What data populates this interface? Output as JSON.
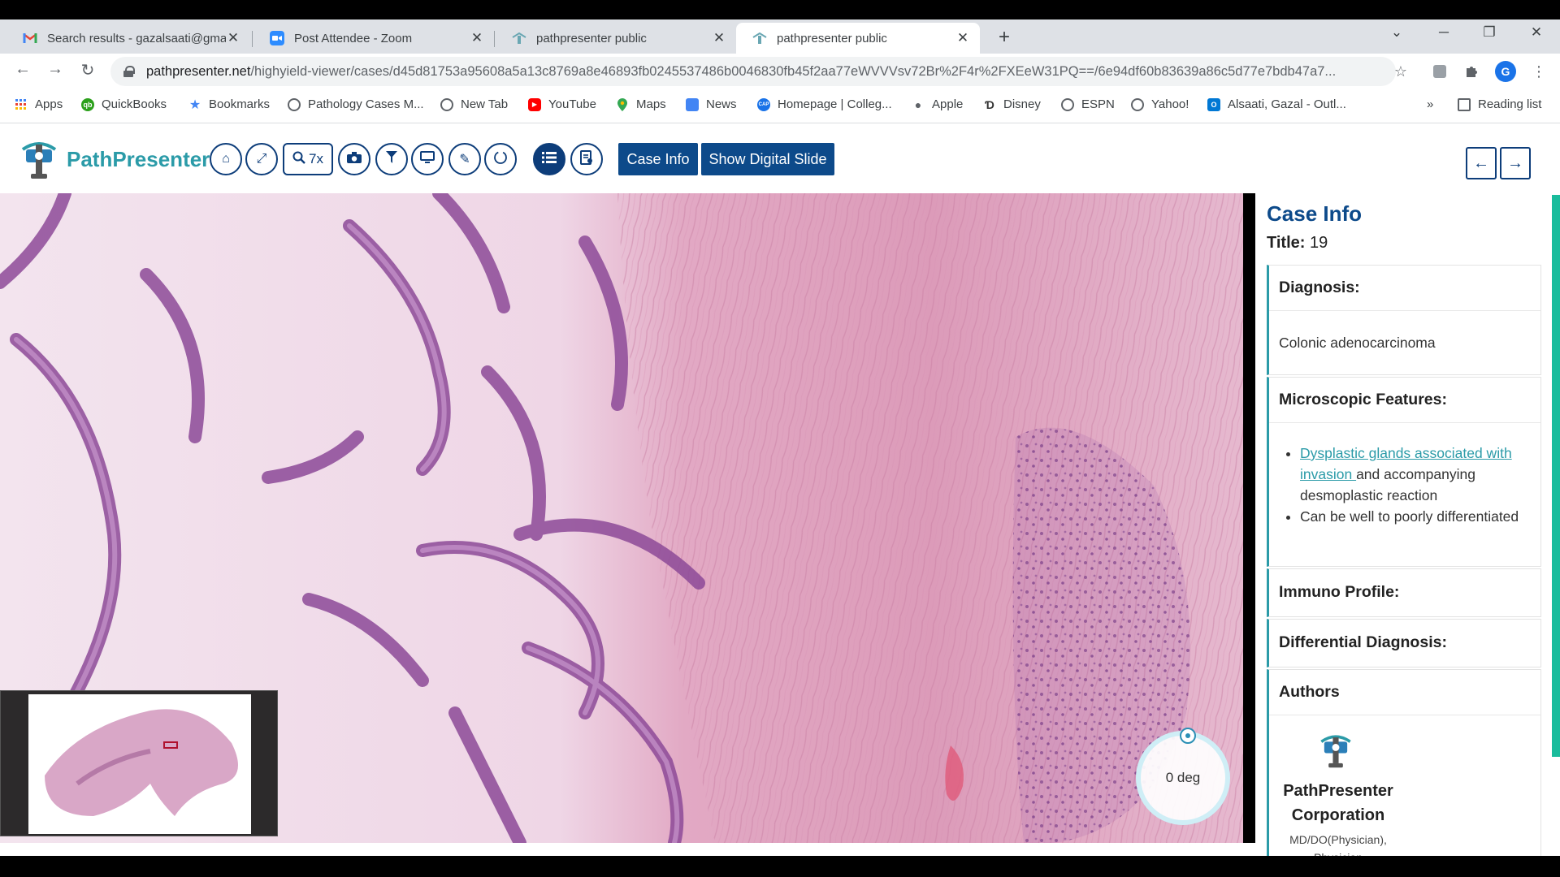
{
  "browser": {
    "tabs": [
      {
        "label": "Search results - gazalsaati@gmail.com",
        "icon": "gmail-icon",
        "active": false
      },
      {
        "label": "Post Attendee - Zoom",
        "icon": "zoom-icon",
        "active": false
      },
      {
        "label": "pathpresenter public",
        "icon": "pathpresenter-icon",
        "active": false
      },
      {
        "label": "pathpresenter public",
        "icon": "pathpresenter-icon",
        "active": true
      }
    ],
    "url_host": "pathpresenter.net",
    "url_path": "/highyield-viewer/cases/d45d81753a95608a5a13c8769a8e46893fb0245537486b0046830fb45f2aa77eWVVVsv72Br%2F4r%2FXEeW31PQ==/6e94df60b83639a86c5d77e7bdb47a7...",
    "profile_initial": "G",
    "bookmarks": [
      {
        "label": "Apps",
        "icon": "apps-grid-icon"
      },
      {
        "label": "QuickBooks",
        "icon": "quickbooks-icon"
      },
      {
        "label": "Bookmarks",
        "icon": "star-icon"
      },
      {
        "label": "Pathology Cases M...",
        "icon": "globe-icon"
      },
      {
        "label": "New Tab",
        "icon": "globe-icon"
      },
      {
        "label": "YouTube",
        "icon": "youtube-icon"
      },
      {
        "label": "Maps",
        "icon": "maps-icon"
      },
      {
        "label": "News",
        "icon": "news-icon"
      },
      {
        "label": "Homepage | Colleg...",
        "icon": "cap-icon"
      },
      {
        "label": "Apple",
        "icon": "apple-icon"
      },
      {
        "label": "Disney",
        "icon": "disney-icon"
      },
      {
        "label": "ESPN",
        "icon": "globe-icon"
      },
      {
        "label": "Yahoo!",
        "icon": "globe-icon"
      },
      {
        "label": "Alsaati, Gazal - Outl...",
        "icon": "outlook-icon"
      }
    ],
    "bookmarks_overflow": "»",
    "reading_list": "Reading list"
  },
  "app": {
    "brand": "PathPresenter",
    "zoom_label": "7x",
    "case_info_button": "Case Info",
    "show_slide_button": "Show Digital Slide",
    "colors": {
      "brand": "#2b9ba8",
      "primary": "#0d4a8a",
      "accent": "#1abc9c"
    }
  },
  "viewer": {
    "rotation_label": "0 deg"
  },
  "panel": {
    "heading": "Case Info",
    "title_label": "Title:",
    "title_value": "19",
    "diagnosis_header": "Diagnosis:",
    "diagnosis_value": "Colonic adenocarcinoma",
    "micro_header": "Microscopic Features:",
    "micro_link": "Dysplastic glands associated with invasion ",
    "micro_item1_rest": "and accompanying desmoplastic reaction",
    "micro_item2": "Can be well to poorly differentiated",
    "immuno_header": "Immuno Profile:",
    "ddx_header": "Differential Diagnosis:",
    "authors_header": "Authors",
    "author_name": "PathPresenter Corporation",
    "author_role": "MD/DO(Physician), Physician"
  }
}
